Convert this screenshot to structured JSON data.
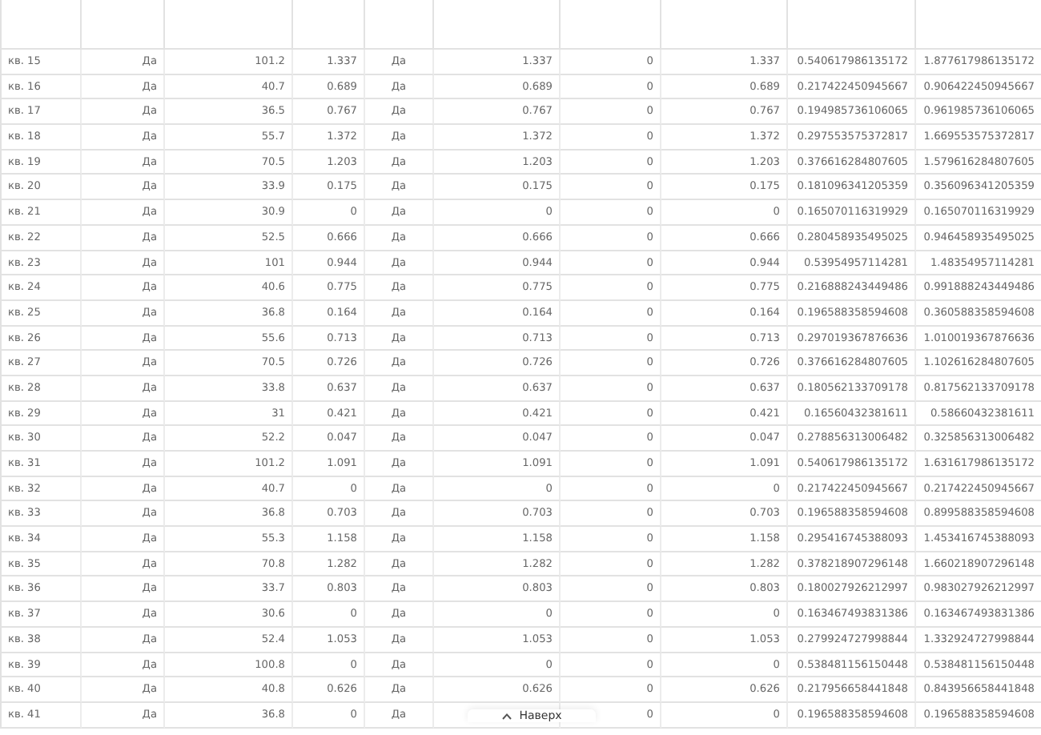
{
  "table": {
    "rows": [
      {
        "label": "кв. 15",
        "column_2": "Да",
        "column_3": "101.2",
        "column_4": "1.337",
        "column_5": "Да",
        "column_6": "1.337",
        "column_7": "0",
        "column_8": "1.337",
        "column_9": "0.540617986135172",
        "column_10": "1.877617986135172"
      },
      {
        "label": "кв. 16",
        "column_2": "Да",
        "column_3": "40.7",
        "column_4": "0.689",
        "column_5": "Да",
        "column_6": "0.689",
        "column_7": "0",
        "column_8": "0.689",
        "column_9": "0.217422450945667",
        "column_10": "0.906422450945667"
      },
      {
        "label": "кв. 17",
        "column_2": "Да",
        "column_3": "36.5",
        "column_4": "0.767",
        "column_5": "Да",
        "column_6": "0.767",
        "column_7": "0",
        "column_8": "0.767",
        "column_9": "0.194985736106065",
        "column_10": "0.961985736106065"
      },
      {
        "label": "кв. 18",
        "column_2": "Да",
        "column_3": "55.7",
        "column_4": "1.372",
        "column_5": "Да",
        "column_6": "1.372",
        "column_7": "0",
        "column_8": "1.372",
        "column_9": "0.297553575372817",
        "column_10": "1.669553575372817"
      },
      {
        "label": "кв. 19",
        "column_2": "Да",
        "column_3": "70.5",
        "column_4": "1.203",
        "column_5": "Да",
        "column_6": "1.203",
        "column_7": "0",
        "column_8": "1.203",
        "column_9": "0.376616284807605",
        "column_10": "1.579616284807605"
      },
      {
        "label": "кв. 20",
        "column_2": "Да",
        "column_3": "33.9",
        "column_4": "0.175",
        "column_5": "Да",
        "column_6": "0.175",
        "column_7": "0",
        "column_8": "0.175",
        "column_9": "0.181096341205359",
        "column_10": "0.356096341205359"
      },
      {
        "label": "кв. 21",
        "column_2": "Да",
        "column_3": "30.9",
        "column_4": "0",
        "column_5": "Да",
        "column_6": "0",
        "column_7": "0",
        "column_8": "0",
        "column_9": "0.165070116319929",
        "column_10": "0.165070116319929"
      },
      {
        "label": "кв. 22",
        "column_2": "Да",
        "column_3": "52.5",
        "column_4": "0.666",
        "column_5": "Да",
        "column_6": "0.666",
        "column_7": "0",
        "column_8": "0.666",
        "column_9": "0.280458935495025",
        "column_10": "0.946458935495025"
      },
      {
        "label": "кв. 23",
        "column_2": "Да",
        "column_3": "101",
        "column_4": "0.944",
        "column_5": "Да",
        "column_6": "0.944",
        "column_7": "0",
        "column_8": "0.944",
        "column_9": "0.53954957114281",
        "column_10": "1.48354957114281"
      },
      {
        "label": "кв. 24",
        "column_2": "Да",
        "column_3": "40.6",
        "column_4": "0.775",
        "column_5": "Да",
        "column_6": "0.775",
        "column_7": "0",
        "column_8": "0.775",
        "column_9": "0.216888243449486",
        "column_10": "0.991888243449486"
      },
      {
        "label": "кв. 25",
        "column_2": "Да",
        "column_3": "36.8",
        "column_4": "0.164",
        "column_5": "Да",
        "column_6": "0.164",
        "column_7": "0",
        "column_8": "0.164",
        "column_9": "0.196588358594608",
        "column_10": "0.360588358594608"
      },
      {
        "label": "кв. 26",
        "column_2": "Да",
        "column_3": "55.6",
        "column_4": "0.713",
        "column_5": "Да",
        "column_6": "0.713",
        "column_7": "0",
        "column_8": "0.713",
        "column_9": "0.297019367876636",
        "column_10": "1.010019367876636"
      },
      {
        "label": "кв. 27",
        "column_2": "Да",
        "column_3": "70.5",
        "column_4": "0.726",
        "column_5": "Да",
        "column_6": "0.726",
        "column_7": "0",
        "column_8": "0.726",
        "column_9": "0.376616284807605",
        "column_10": "1.102616284807605"
      },
      {
        "label": "кв. 28",
        "column_2": "Да",
        "column_3": "33.8",
        "column_4": "0.637",
        "column_5": "Да",
        "column_6": "0.637",
        "column_7": "0",
        "column_8": "0.637",
        "column_9": "0.180562133709178",
        "column_10": "0.817562133709178"
      },
      {
        "label": "кв. 29",
        "column_2": "Да",
        "column_3": "31",
        "column_4": "0.421",
        "column_5": "Да",
        "column_6": "0.421",
        "column_7": "0",
        "column_8": "0.421",
        "column_9": "0.16560432381611",
        "column_10": "0.58660432381611"
      },
      {
        "label": "кв. 30",
        "column_2": "Да",
        "column_3": "52.2",
        "column_4": "0.047",
        "column_5": "Да",
        "column_6": "0.047",
        "column_7": "0",
        "column_8": "0.047",
        "column_9": "0.278856313006482",
        "column_10": "0.325856313006482"
      },
      {
        "label": "кв. 31",
        "column_2": "Да",
        "column_3": "101.2",
        "column_4": "1.091",
        "column_5": "Да",
        "column_6": "1.091",
        "column_7": "0",
        "column_8": "1.091",
        "column_9": "0.540617986135172",
        "column_10": "1.631617986135172"
      },
      {
        "label": "кв. 32",
        "column_2": "Да",
        "column_3": "40.7",
        "column_4": "0",
        "column_5": "Да",
        "column_6": "0",
        "column_7": "0",
        "column_8": "0",
        "column_9": "0.217422450945667",
        "column_10": "0.217422450945667"
      },
      {
        "label": "кв. 33",
        "column_2": "Да",
        "column_3": "36.8",
        "column_4": "0.703",
        "column_5": "Да",
        "column_6": "0.703",
        "column_7": "0",
        "column_8": "0.703",
        "column_9": "0.196588358594608",
        "column_10": "0.899588358594608"
      },
      {
        "label": "кв. 34",
        "column_2": "Да",
        "column_3": "55.3",
        "column_4": "1.158",
        "column_5": "Да",
        "column_6": "1.158",
        "column_7": "0",
        "column_8": "1.158",
        "column_9": "0.295416745388093",
        "column_10": "1.453416745388093"
      },
      {
        "label": "кв. 35",
        "column_2": "Да",
        "column_3": "70.8",
        "column_4": "1.282",
        "column_5": "Да",
        "column_6": "1.282",
        "column_7": "0",
        "column_8": "1.282",
        "column_9": "0.378218907296148",
        "column_10": "1.660218907296148"
      },
      {
        "label": "кв. 36",
        "column_2": "Да",
        "column_3": "33.7",
        "column_4": "0.803",
        "column_5": "Да",
        "column_6": "0.803",
        "column_7": "0",
        "column_8": "0.803",
        "column_9": "0.180027926212997",
        "column_10": "0.983027926212997"
      },
      {
        "label": "кв. 37",
        "column_2": "Да",
        "column_3": "30.6",
        "column_4": "0",
        "column_5": "Да",
        "column_6": "0",
        "column_7": "0",
        "column_8": "0",
        "column_9": "0.163467493831386",
        "column_10": "0.163467493831386"
      },
      {
        "label": "кв. 38",
        "column_2": "Да",
        "column_3": "52.4",
        "column_4": "1.053",
        "column_5": "Да",
        "column_6": "1.053",
        "column_7": "0",
        "column_8": "1.053",
        "column_9": "0.279924727998844",
        "column_10": "1.332924727998844"
      },
      {
        "label": "кв. 39",
        "column_2": "Да",
        "column_3": "100.8",
        "column_4": "0",
        "column_5": "Да",
        "column_6": "0",
        "column_7": "0",
        "column_8": "0",
        "column_9": "0.538481156150448",
        "column_10": "0.538481156150448"
      },
      {
        "label": "кв. 40",
        "column_2": "Да",
        "column_3": "40.8",
        "column_4": "0.626",
        "column_5": "Да",
        "column_6": "0.626",
        "column_7": "0",
        "column_8": "0.626",
        "column_9": "0.217956658441848",
        "column_10": "0.843956658441848"
      },
      {
        "label": "кв. 41",
        "column_2": "Да",
        "column_3": "36.8",
        "column_4": "0",
        "column_5": "Да",
        "column_7": "0",
        "column_8": "0",
        "column_9": "0.196588358594608",
        "column_10": "0.196588358594608"
      }
    ]
  },
  "scroll_top_button": {
    "label": "Наверх"
  }
}
